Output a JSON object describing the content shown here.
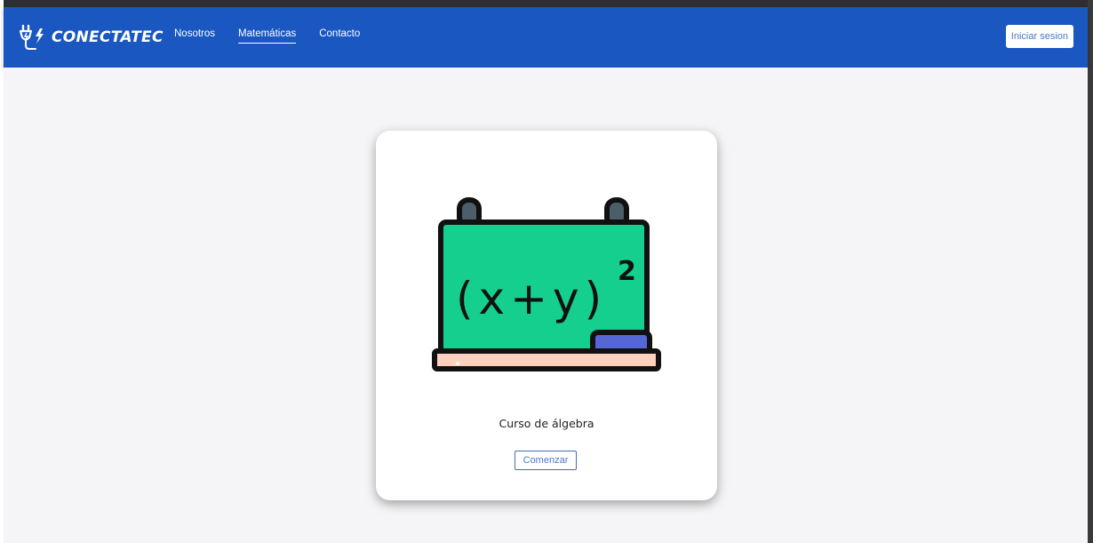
{
  "brand": {
    "name": "CONECTATEC",
    "logo_icon": "plug-bolt-icon"
  },
  "nav": {
    "links": [
      {
        "label": "Nosotros",
        "active": false
      },
      {
        "label": "Matemáticas",
        "active": true
      },
      {
        "label": "Contacto",
        "active": false
      }
    ],
    "login_label": "Iniciar sesion"
  },
  "card": {
    "illustration": {
      "icon": "chalkboard-icon",
      "formula": "(x+y)",
      "exponent": "2"
    },
    "title": "Curso de álgebra",
    "button_label": "Comenzar"
  },
  "colors": {
    "navbar": "#1a57c1",
    "background": "#f5f5f7",
    "board": "#14cf8e",
    "eraser": "#5566d6",
    "tray": "#ffd0bd"
  }
}
